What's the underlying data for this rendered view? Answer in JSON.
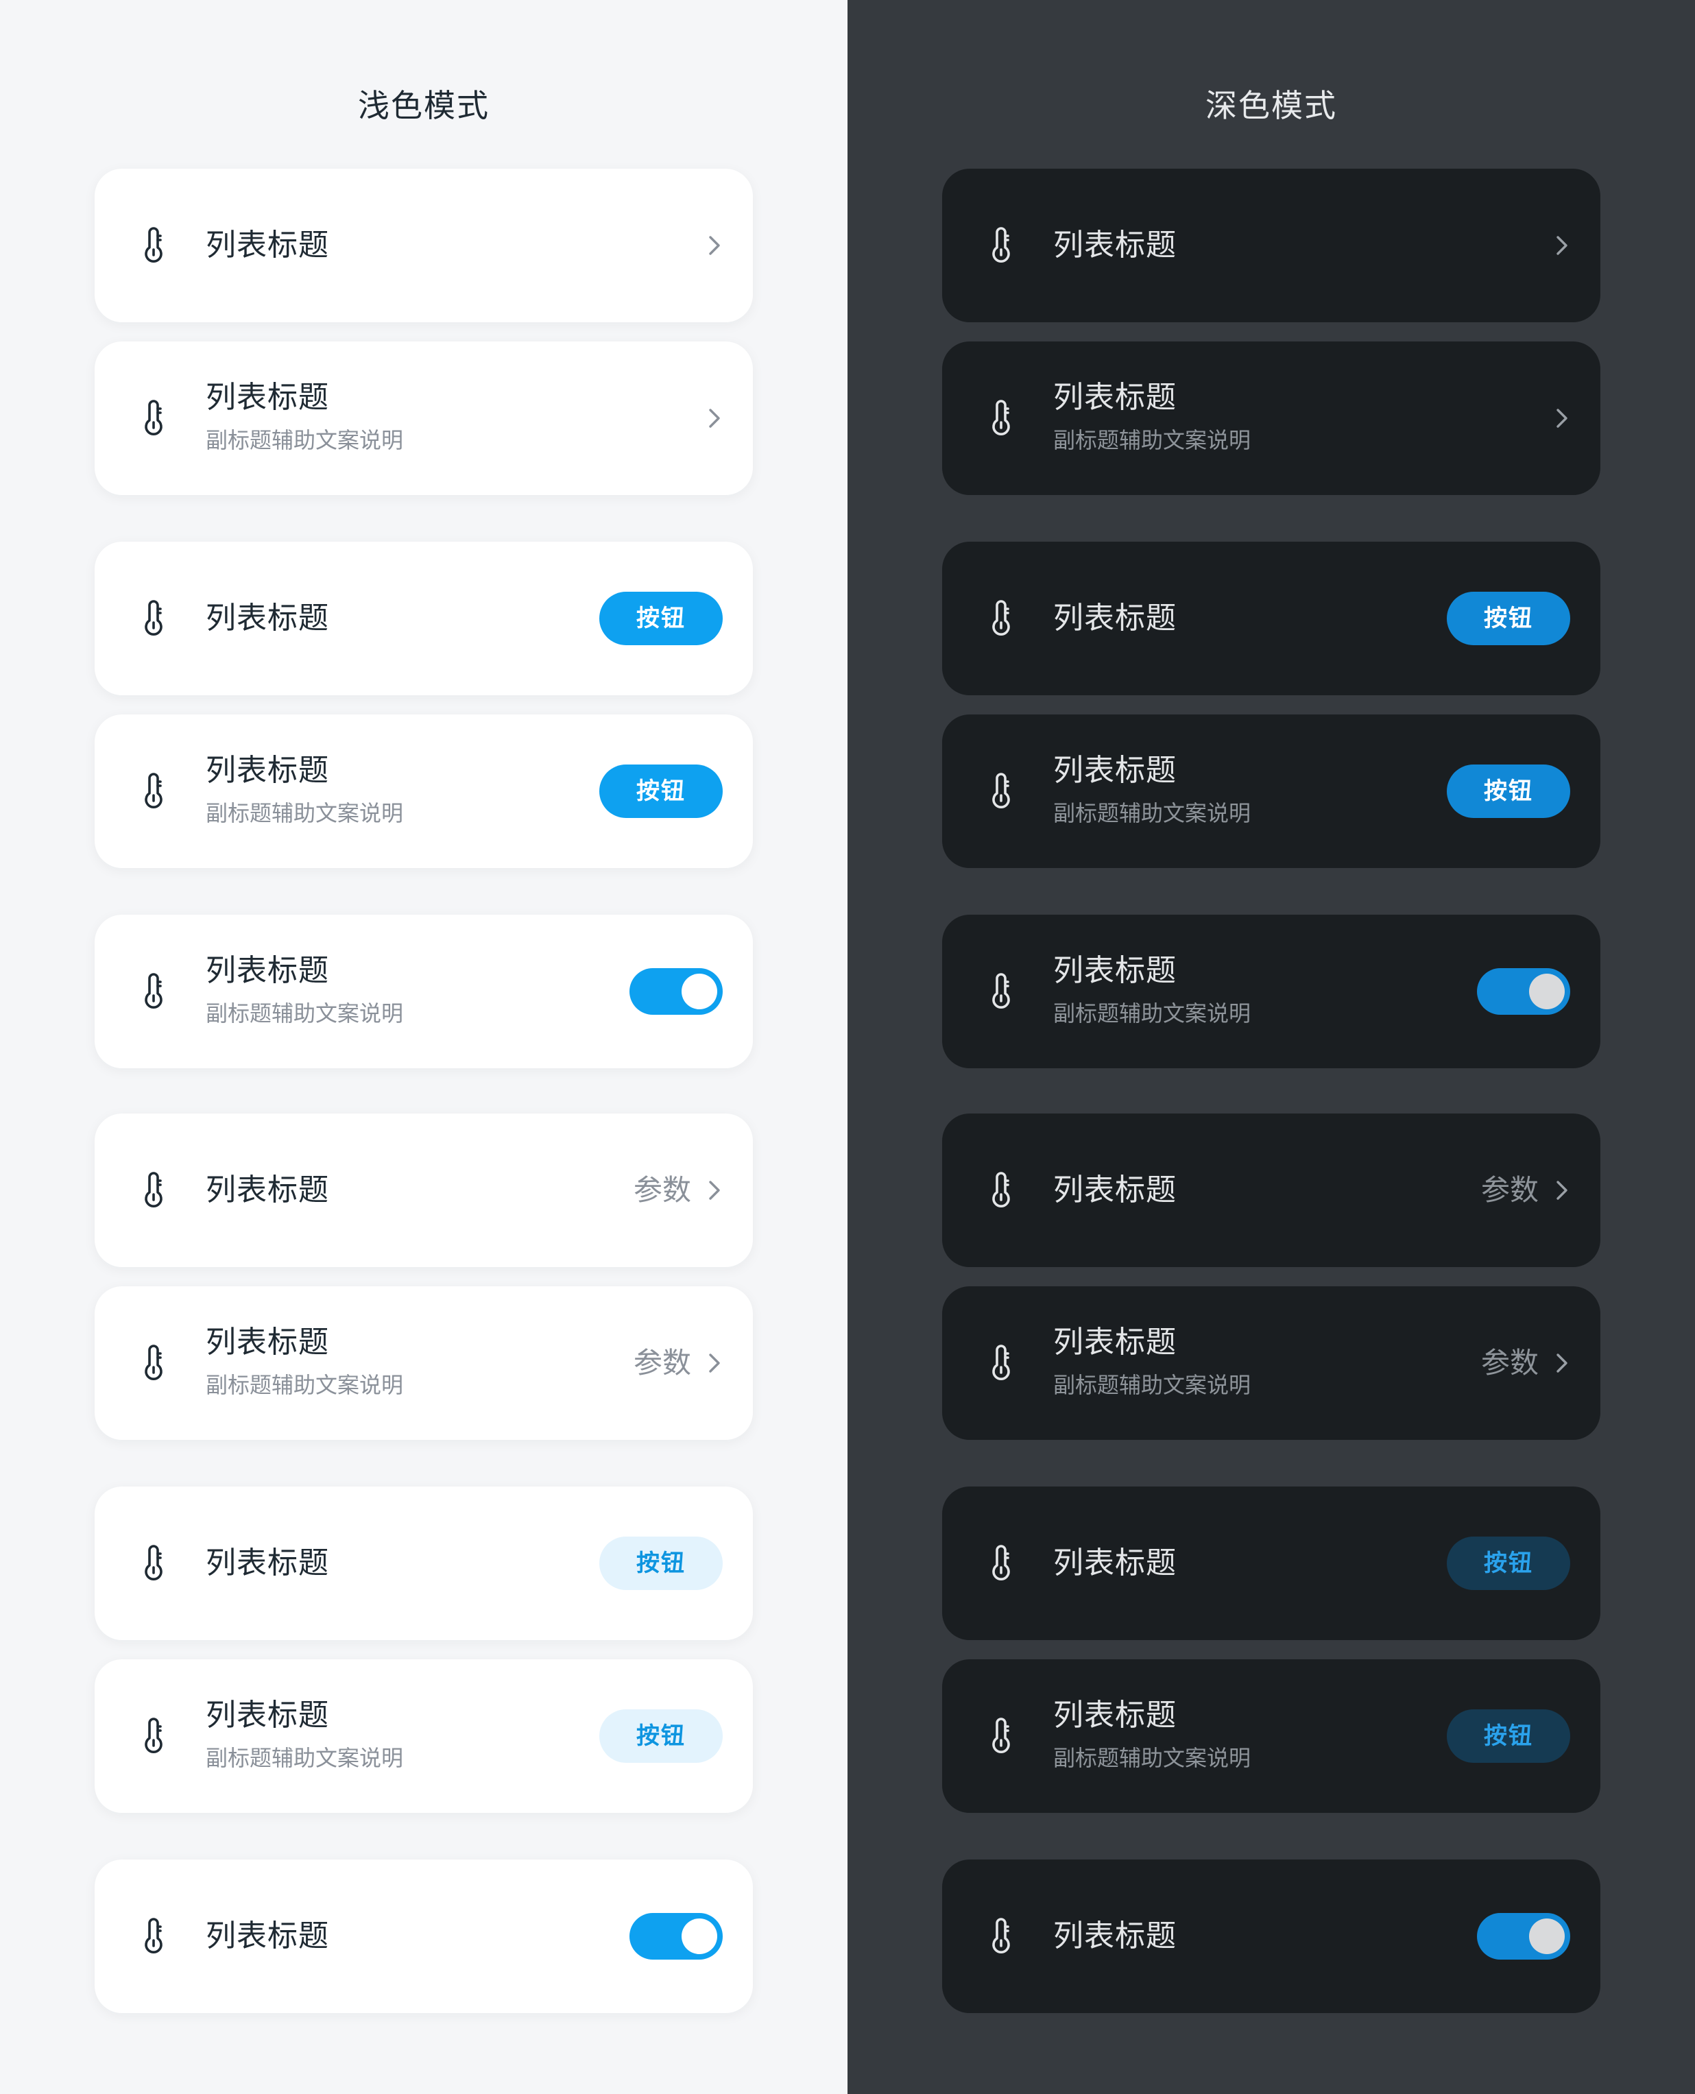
{
  "colors": {
    "accent": "#0ea1f0",
    "light_bg": "#f5f6f8",
    "dark_bg": "#363a3f",
    "light_card": "#ffffff",
    "dark_card": "#1a1e21",
    "soft_button_light": "#e3f3fd",
    "soft_button_dark": "#153a52"
  },
  "icon_name": "thermometer-icon",
  "light": {
    "title": "浅色模式",
    "rows": [
      {
        "title": "列表标题",
        "trailing": "chevron"
      },
      {
        "title": "列表标题",
        "subtitle": "副标题辅助文案说明",
        "trailing": "chevron"
      },
      {
        "title": "列表标题",
        "trailing": "button",
        "button": "按钮"
      },
      {
        "title": "列表标题",
        "subtitle": "副标题辅助文案说明",
        "trailing": "button",
        "button": "按钮"
      },
      {
        "title": "列表标题",
        "subtitle": "副标题辅助文案说明",
        "trailing": "toggle",
        "toggle_on": true
      },
      {
        "title": "列表标题",
        "trailing": "param",
        "param": "参数"
      },
      {
        "title": "列表标题",
        "subtitle": "副标题辅助文案说明",
        "trailing": "param",
        "param": "参数"
      },
      {
        "title": "列表标题",
        "trailing": "soft-button",
        "button": "按钮"
      },
      {
        "title": "列表标题",
        "subtitle": "副标题辅助文案说明",
        "trailing": "soft-button",
        "button": "按钮"
      },
      {
        "title": "列表标题",
        "trailing": "toggle",
        "toggle_on": true
      }
    ]
  },
  "dark": {
    "title": "深色模式",
    "rows": [
      {
        "title": "列表标题",
        "trailing": "chevron"
      },
      {
        "title": "列表标题",
        "subtitle": "副标题辅助文案说明",
        "trailing": "chevron"
      },
      {
        "title": "列表标题",
        "trailing": "button",
        "button": "按钮"
      },
      {
        "title": "列表标题",
        "subtitle": "副标题辅助文案说明",
        "trailing": "button",
        "button": "按钮"
      },
      {
        "title": "列表标题",
        "subtitle": "副标题辅助文案说明",
        "trailing": "toggle",
        "toggle_on": true
      },
      {
        "title": "列表标题",
        "trailing": "param",
        "param": "参数"
      },
      {
        "title": "列表标题",
        "subtitle": "副标题辅助文案说明",
        "trailing": "param",
        "param": "参数"
      },
      {
        "title": "列表标题",
        "trailing": "soft-button",
        "button": "按钮"
      },
      {
        "title": "列表标题",
        "subtitle": "副标题辅助文案说明",
        "trailing": "soft-button",
        "button": "按钮"
      },
      {
        "title": "列表标题",
        "trailing": "toggle",
        "toggle_on": true
      }
    ]
  }
}
